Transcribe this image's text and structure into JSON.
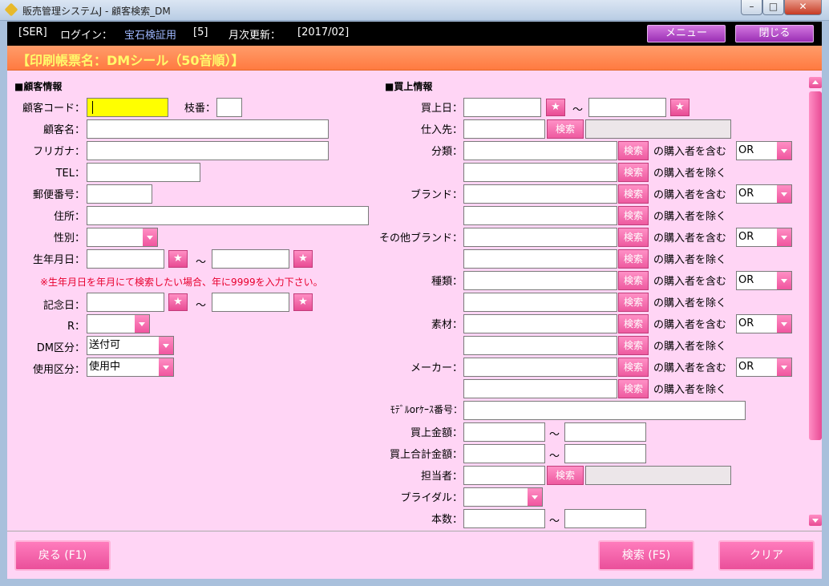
{
  "window": {
    "title": "販売管理システムJ - 顧客検索_DM"
  },
  "header": {
    "ser": "[SER]",
    "login_label": "ログイン：",
    "user": "宝石検証用",
    "user_id": "[5]",
    "monthly_label": "月次更新：",
    "monthly_value": "[2017/02]",
    "menu_button": "メニュー",
    "close_button": "閉じる"
  },
  "form_title": "【印刷帳票名：DMシール（50音順）】",
  "customer": {
    "section": "■顧客情報",
    "code_label": "顧客コード：",
    "branch_label": "枝番：",
    "name_label": "顧客名：",
    "kana_label": "フリガナ：",
    "tel_label": "TEL：",
    "zip_label": "郵便番号：",
    "address_label": "住所：",
    "gender_label": "性別：",
    "birthday_label": "生年月日：",
    "birthday_note": "※生年月日を年月にて検索したい場合、年に9999を入力下さい。",
    "anniversary_label": "記念日：",
    "r_label": "R：",
    "dm_label": "DM区分：",
    "dm_value": "送付可",
    "use_label": "使用区分：",
    "use_value": "使用中",
    "star": "★",
    "tilde": "～"
  },
  "sales": {
    "section": "■買上情報",
    "date_label": "買上日：",
    "supplier_label": "仕入先：",
    "search_label": "検索",
    "include_text": "の購入者を含む",
    "exclude_text": "の購入者を除く",
    "or_value": "OR",
    "category_label": "分類：",
    "brand_label": "ブランド：",
    "other_brand_label": "その他ブランド：",
    "kind_label": "種類：",
    "material_label": "素材：",
    "maker_label": "メーカー：",
    "model_label": "ﾓﾃﾞﾙorｹｰｽ番号：",
    "amount_label": "買上金額：",
    "total_label": "買上合計金額：",
    "staff_label": "担当者：",
    "bridal_label": "ブライダル：",
    "count_label": "本数："
  },
  "footer": {
    "back": "戻る (F1)",
    "search": "検索 (F5)",
    "clear": "クリア"
  }
}
